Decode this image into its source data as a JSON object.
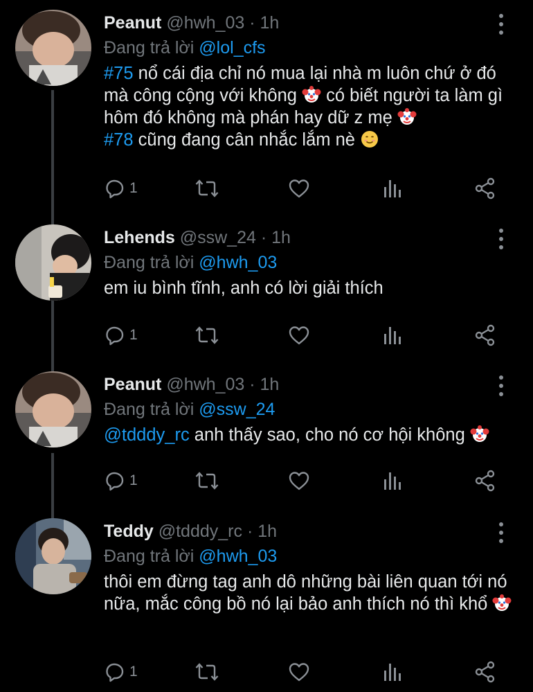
{
  "tweets": [
    {
      "name": "Peanut",
      "handle": "@hwh_03",
      "time": "· 1h",
      "replying_label": "Đang trả lời",
      "replying_to": "@lol_cfs",
      "body": [
        [
          {
            "t": "link",
            "v": "#75"
          },
          {
            "t": "text",
            "v": " nổ cái địa chỉ nó mua lại nhà m luôn chứ ở đó mà công cộng với không "
          },
          {
            "t": "emoji",
            "v": "clown"
          },
          {
            "t": "text",
            "v": " có biết người ta làm gì hôm đó không mà phán hay dữ z mẹ "
          },
          {
            "t": "emoji",
            "v": "clown"
          }
        ],
        [
          {
            "t": "link",
            "v": "#78"
          },
          {
            "t": "text",
            "v": " cũng đang cân nhắc lắm nè "
          },
          {
            "t": "emoji",
            "v": "smile"
          }
        ]
      ],
      "reply_count": "1",
      "avatar": "peanut"
    },
    {
      "name": "Lehends",
      "handle": "@ssw_24",
      "time": "· 1h",
      "replying_label": "Đang trả lời",
      "replying_to": "@hwh_03",
      "body": [
        [
          {
            "t": "text",
            "v": "em iu bình tĩnh, anh có lời giải thích"
          }
        ]
      ],
      "reply_count": "1",
      "avatar": "lehends"
    },
    {
      "name": "Peanut",
      "handle": "@hwh_03",
      "time": "· 1h",
      "replying_label": "Đang trả lời",
      "replying_to": "@ssw_24",
      "body": [
        [
          {
            "t": "link",
            "v": "@tdddy_rc"
          },
          {
            "t": "text",
            "v": " anh thấy sao, cho nó cơ hội không "
          },
          {
            "t": "emoji",
            "v": "clown"
          }
        ]
      ],
      "reply_count": "1",
      "avatar": "peanut"
    },
    {
      "name": "Teddy",
      "handle": "@tdddy_rc",
      "time": "· 1h",
      "replying_label": "Đang trả lời",
      "replying_to": "@hwh_03",
      "body": [
        [
          {
            "t": "text",
            "v": "thôi em đừng tag anh dô những bài liên quan tới nó nữa, mắc công bồ nó lại bảo anh thích nó thì khổ "
          },
          {
            "t": "emoji",
            "v": "clown"
          }
        ]
      ],
      "reply_count": "1",
      "avatar": "teddy"
    }
  ],
  "icons": {
    "reply": "reply-icon",
    "retweet": "retweet-icon",
    "like": "heart-icon",
    "views": "views-icon",
    "share": "share-icon",
    "more": "more-icon"
  },
  "colors": {
    "background": "#000000",
    "link": "#1d9bf0",
    "muted": "#71767b",
    "text": "#e7e9ea",
    "thread_line": "#3a3e42"
  }
}
